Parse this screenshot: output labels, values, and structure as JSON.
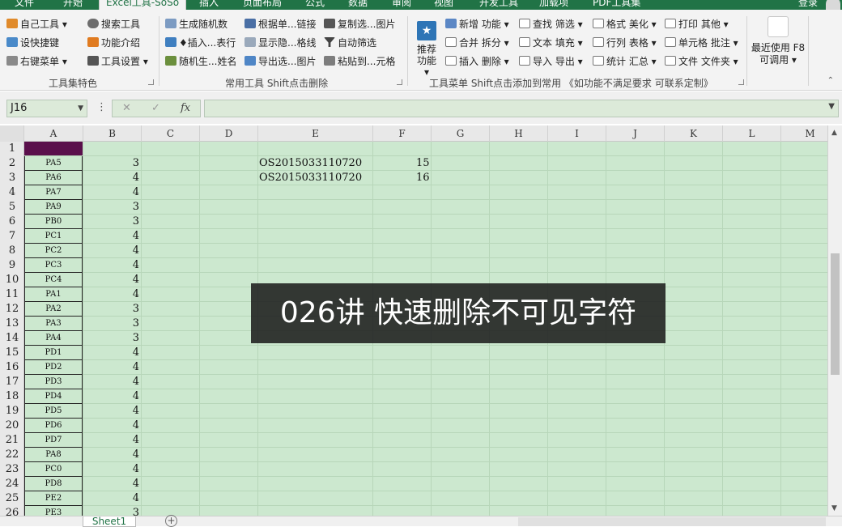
{
  "tabs": [
    "文件",
    "开始",
    "Excel工具-SoSo",
    "插入",
    "页面布局",
    "公式",
    "数据",
    "审阅",
    "视图",
    "开发工具",
    "加载项",
    "PDF工具集"
  ],
  "active_tab_index": 2,
  "login": "登录",
  "ribbon": {
    "group1": {
      "items": [
        "自己工具 ▾",
        "设快捷键",
        "右键菜单 ▾",
        "搜索工具",
        "功能介绍",
        "工具设置 ▾"
      ],
      "label": "工具集特色"
    },
    "group2": {
      "items": [
        "生成随机数",
        "♦插入...表行",
        "随机生...姓名",
        "根据单...链接",
        "显示隐...格线",
        "导出选...图片",
        "复制选...图片",
        "自动筛选",
        "粘贴到...元格"
      ],
      "label": "常用工具 Shift点击删除"
    },
    "group3": {
      "recommend_label": "推荐功能 ▾",
      "items": [
        "新增 功能 ▾",
        "合并 拆分 ▾",
        "插入 删除 ▾",
        "查找 筛选 ▾",
        "文本 填充 ▾",
        "导入 导出 ▾",
        "格式 美化 ▾",
        "行列 表格 ▾",
        "统计 汇总 ▾",
        "打印 其他 ▾",
        "单元格 批注 ▾",
        "文件 文件夹 ▾"
      ],
      "label": "工具菜单 Shift点击添加到常用 《如功能不满足要求 可联系定制》"
    },
    "recent": {
      "line1": "最近使用 F8",
      "line2": "可调用 ▾"
    }
  },
  "formula_bar": {
    "name_box": "J16",
    "fx": "fx",
    "value": ""
  },
  "columns": [
    "A",
    "B",
    "C",
    "D",
    "E",
    "F",
    "G",
    "H",
    "I",
    "J",
    "K",
    "L",
    "M"
  ],
  "rows": [
    "1",
    "2",
    "3",
    "4",
    "5",
    "6",
    "7",
    "8",
    "9",
    "10",
    "11",
    "12",
    "13",
    "14",
    "15",
    "16",
    "17",
    "18",
    "19",
    "20",
    "21",
    "22",
    "23",
    "24",
    "25",
    "26"
  ],
  "colA": [
    "",
    "PA5",
    "PA6",
    "PA7",
    "PA9",
    "PB0",
    "PC1",
    "PC2",
    "PC3",
    "PC4",
    "PA1",
    "PA2",
    "PA3",
    "PA4",
    "PD1",
    "PD2",
    "PD3",
    "PD4",
    "PD5",
    "PD6",
    "PD7",
    "PA8",
    "PC0",
    "PD8",
    "PE2",
    "PE3"
  ],
  "colB": [
    "",
    "3",
    "4",
    "4",
    "3",
    "3",
    "4",
    "4",
    "4",
    "4",
    "4",
    "3",
    "3",
    "3",
    "4",
    "4",
    "4",
    "4",
    "4",
    "4",
    "4",
    "4",
    "4",
    "4",
    "4",
    "3"
  ],
  "colE": [
    "",
    "OS2015033110720",
    "OS2015033110720"
  ],
  "colF": [
    "",
    "15",
    "16"
  ],
  "caption": "026讲 快速删除不可见字符",
  "sheet_tab": "Sheet1",
  "colors": {
    "accent": "#217346",
    "grid_bg": "#cce8cf",
    "a1_fill": "#5a0f4b"
  }
}
